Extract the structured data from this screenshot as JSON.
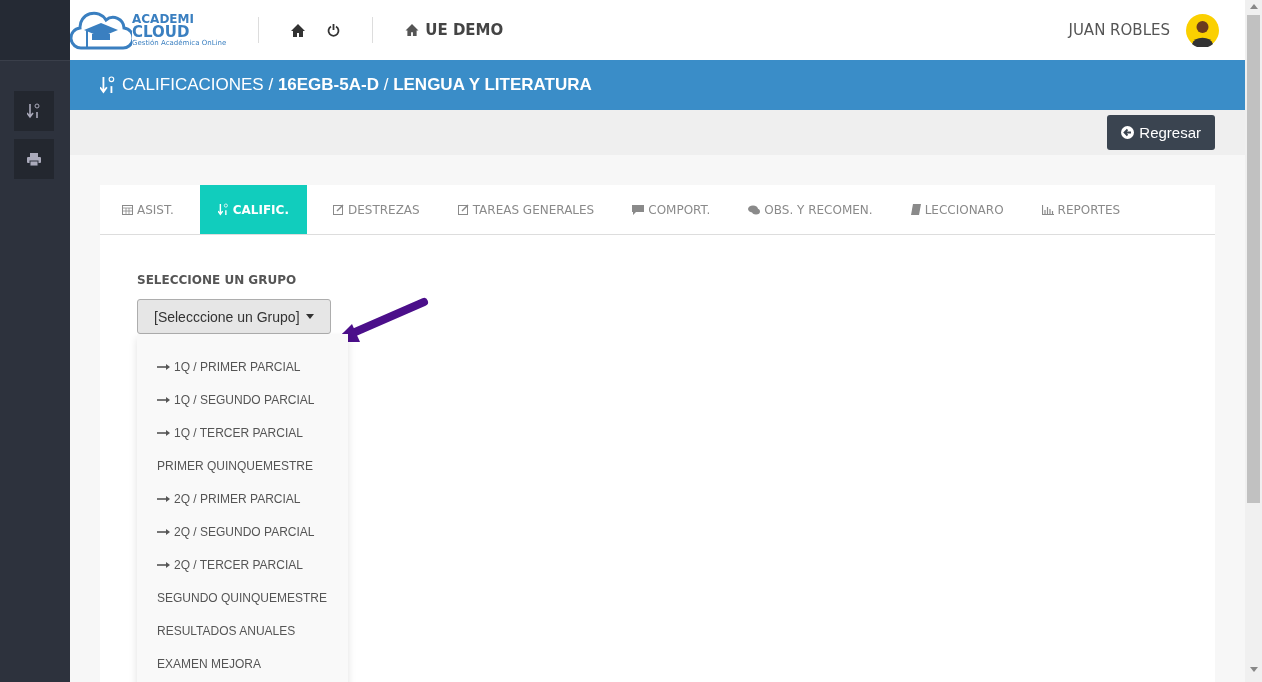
{
  "logo": {
    "line1": "ACADEMI",
    "line2": "CLOUD",
    "tagline": "Gestión Académica OnLine"
  },
  "header": {
    "school": "UE DEMO",
    "user": "JUAN ROBLES"
  },
  "breadcrumb": "CALIFICACIONES / **16EGB-5A-D** / **LENGUA Y LITERATURA**",
  "back_button": "Regresar",
  "tabs": [
    {
      "label": "ASIST.",
      "kind": "calendar",
      "selected": false
    },
    {
      "label": "CALIFIC.",
      "kind": "sort",
      "selected": true
    },
    {
      "label": "DESTREZAS",
      "kind": "edit",
      "selected": false
    },
    {
      "label": "TAREAS GENERALES",
      "kind": "edit",
      "selected": false
    },
    {
      "label": "COMPORT.",
      "kind": "comment",
      "selected": false
    },
    {
      "label": "OBS. Y RECOMEN.",
      "kind": "comments",
      "selected": false
    },
    {
      "label": "LECCIONARO",
      "kind": "book",
      "selected": false
    },
    {
      "label": "REPORTES",
      "kind": "chart",
      "selected": false
    }
  ],
  "group_label": "SELECCIONE UN GRUPO",
  "group_dropdown": "[Selecccione un Grupo]",
  "group_options": [
    {
      "label": "1Q / PRIMER PARCIAL",
      "kind": "sub"
    },
    {
      "label": "1Q / SEGUNDO PARCIAL",
      "kind": "sub"
    },
    {
      "label": "1Q / TERCER PARCIAL",
      "kind": "sub"
    },
    {
      "label": "PRIMER QUINQUEMESTRE",
      "kind": "main"
    },
    {
      "label": "2Q / PRIMER PARCIAL",
      "kind": "sub"
    },
    {
      "label": "2Q / SEGUNDO PARCIAL",
      "kind": "sub"
    },
    {
      "label": "2Q / TERCER PARCIAL",
      "kind": "sub"
    },
    {
      "label": "SEGUNDO QUINQUEMESTRE",
      "kind": "main"
    },
    {
      "label": "RESULTADOS ANUALES",
      "kind": "main"
    },
    {
      "label": "EXAMEN MEJORA",
      "kind": "main"
    }
  ]
}
